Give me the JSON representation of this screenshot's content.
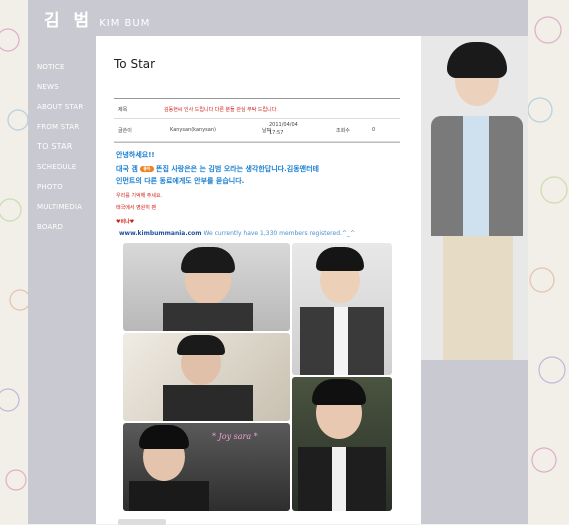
{
  "header": {
    "logo_korean": "김 범",
    "logo_english": "KIM BUM"
  },
  "nav": {
    "items": [
      "NOTICE",
      "NEWS",
      "ABOUT STAR",
      "FROM STAR",
      "TO STAR",
      "SCHEDULE",
      "PHOTO",
      "MULTIMEDIA",
      "BOARD"
    ],
    "active": "TO STAR"
  },
  "page": {
    "title": "To Star"
  },
  "post": {
    "subject_label": "제목",
    "subject": "김동현씨 인사 드립니다 다른 분들 관심 부탁 드립니다",
    "author_label": "글쓴이",
    "author": "Kanysan(kanysan)",
    "date_label": "날짜",
    "date_line1": "2011/04/04",
    "date_line2": "17:57",
    "views_label": "조회수",
    "views": "0"
  },
  "message": {
    "line1": "안녕하세요!!",
    "line2a": "대국 겜",
    "badge": "좋아",
    "line2b": "뜬집 사랑은은 는 김범 오라는 생각한답니다.김동앤터테",
    "line3": "인먼트의 다른 동료에게도 안부를 묻습니다.",
    "line4": "우리를 기억해 주세요.",
    "line5": "태국에서 영원히 팬",
    "sign": "♥비나♥"
  },
  "link": {
    "url": "www.kimbummania.com",
    "text": "We currently have 1,330 members registered.^_^"
  },
  "collage": {
    "caption": "* Joy sara *"
  },
  "colors": {
    "sidebar": "#c9c9d1",
    "blue_text": "#1a7fd0",
    "red_text": "#d0201a"
  }
}
